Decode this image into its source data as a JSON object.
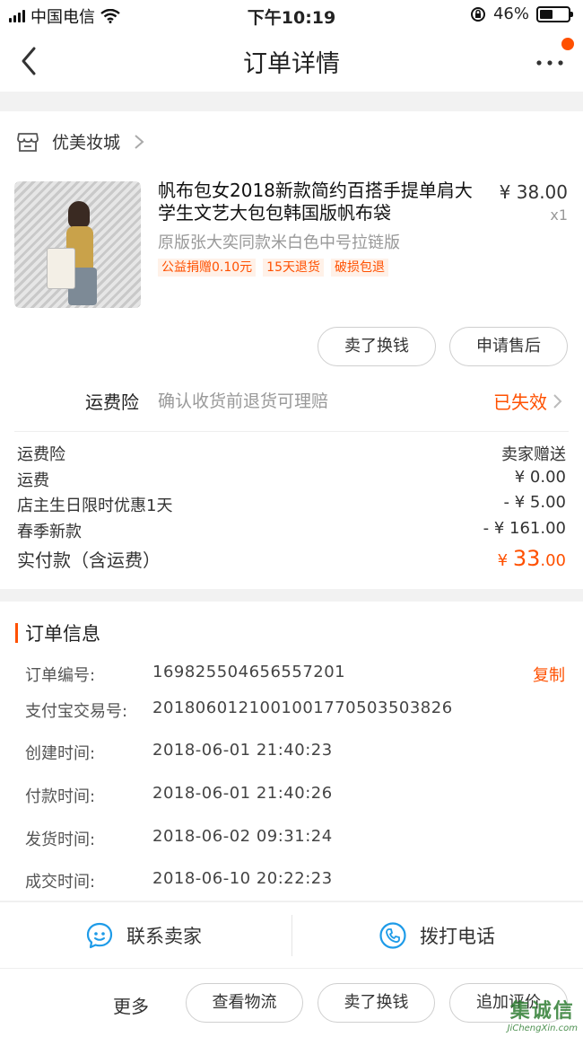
{
  "status_bar": {
    "carrier": "中国电信",
    "time": "下午10:19",
    "battery": "46%",
    "battery_level": 0.46
  },
  "nav": {
    "title": "订单详情"
  },
  "shop": {
    "name": "优美妆城"
  },
  "product": {
    "title": "帆布包女2018新款简约百搭手提单肩大学生文艺大包包韩国版帆布袋",
    "price": "¥ 38.00",
    "qty": "x1",
    "sku": "原版张大奕同款米白色中号拉链版",
    "tags": [
      "公益捐赠0.10元",
      "15天退货",
      "破损包退"
    ]
  },
  "product_actions": {
    "sell": "卖了换钱",
    "after_sale": "申请售后"
  },
  "insurance": {
    "label": "运费险",
    "desc": "确认收货前退货可理赔",
    "status": "已失效"
  },
  "fees": [
    {
      "label": "运费险",
      "value": "卖家赠送"
    },
    {
      "label": "运费",
      "value": "¥ 0.00"
    },
    {
      "label": "店主生日限时优惠1天",
      "value": "- ¥ 5.00"
    },
    {
      "label": "春季新款",
      "value": "- ¥ 161.00"
    }
  ],
  "total": {
    "label": "实付款（含运费）",
    "currency": "¥ ",
    "int": "33",
    "dec": ".00"
  },
  "order_info": {
    "title": "订单信息",
    "copy": "复制",
    "rows": [
      {
        "key": "订单编号:",
        "value": "169825504656557201"
      },
      {
        "key": "支付宝交易号:",
        "value": "2018060121001001770503503826"
      },
      {
        "key": "创建时间:",
        "value": "2018-06-01 21:40:23"
      },
      {
        "key": "付款时间:",
        "value": "2018-06-01 21:40:26"
      },
      {
        "key": "发货时间:",
        "value": "2018-06-02 09:31:24"
      },
      {
        "key": "成交时间:",
        "value": "2018-06-10 20:22:23"
      }
    ]
  },
  "contact": {
    "seller": "联系卖家",
    "phone": "拨打电话"
  },
  "bottom": {
    "more": "更多",
    "logistics": "查看物流",
    "sell": "卖了换钱",
    "review": "追加评价"
  },
  "watermark": {
    "main": "集诚信",
    "sub": "JiChengXin.com"
  },
  "colors": {
    "accent": "#ff5000",
    "background": "#f2f2f2"
  }
}
